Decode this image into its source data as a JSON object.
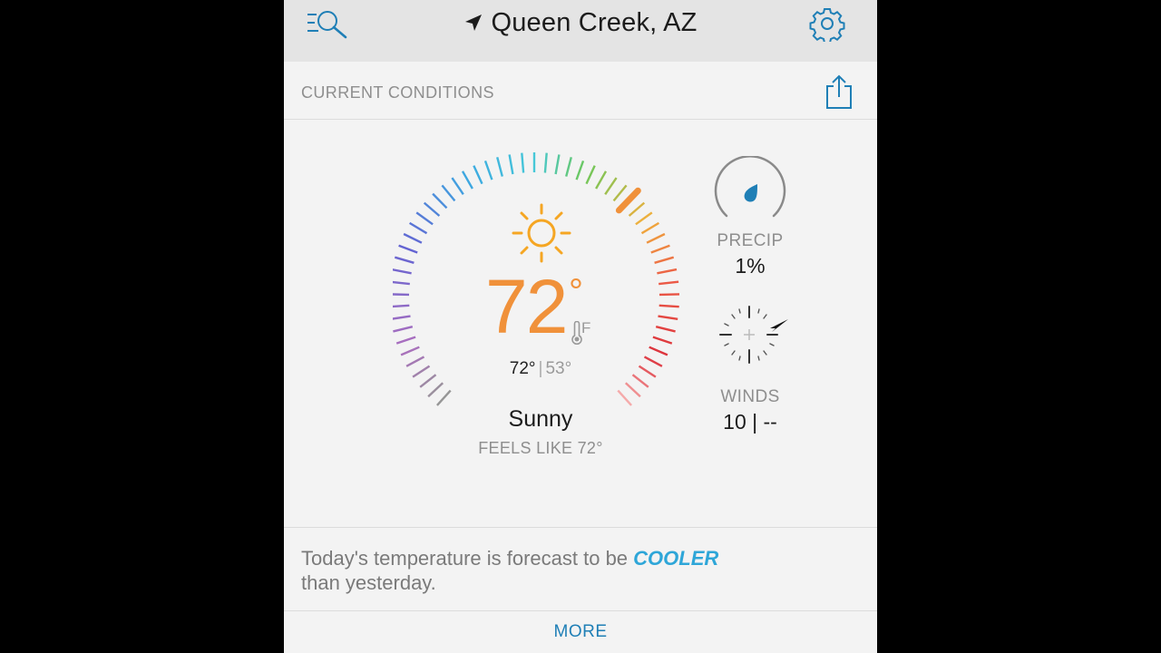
{
  "header": {
    "location": "Queen Creek, AZ",
    "icons": {
      "menu_search": "menu-search-icon",
      "location": "location-arrow-icon",
      "settings": "gear-icon"
    }
  },
  "section": {
    "title": "CURRENT CONDITIONS",
    "share_icon": "share-icon"
  },
  "current": {
    "icon": "sun-icon",
    "temperature": "72",
    "degree_symbol": "°",
    "unit": "F",
    "high": "72°",
    "low": "53°",
    "condition": "Sunny",
    "feels_like": "FEELS LIKE 72°",
    "gauge_fraction": 0.66
  },
  "precip": {
    "label": "PRECIP",
    "value": "1%",
    "icon": "raindrop-icon"
  },
  "winds": {
    "label": "WINDS",
    "value": "10 | --",
    "icon": "wind-compass-icon"
  },
  "forecast_note": {
    "prefix": "Today's temperature is forecast to be",
    "highlight": "COOLER",
    "suffix": "than yesterday."
  },
  "more_label": "MORE",
  "colors": {
    "temperature": "#f0913a",
    "accent": "#2ea6d8",
    "link": "#1f7fb6"
  }
}
